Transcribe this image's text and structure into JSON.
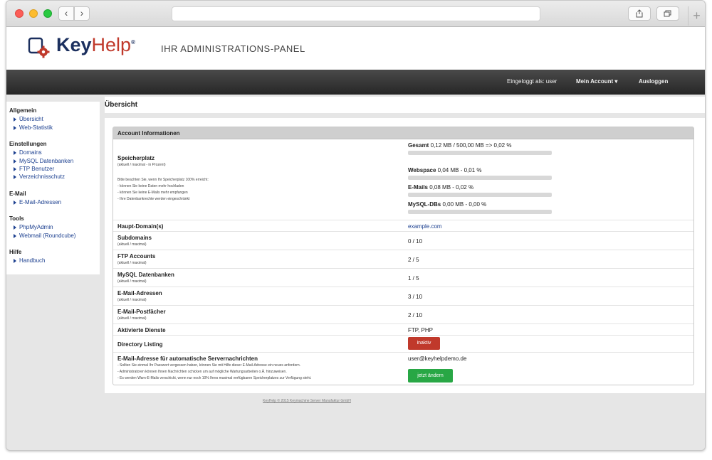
{
  "header": {
    "logo_key": "Key",
    "logo_help": "Help",
    "logo_reg": "®",
    "tagline": "IHR ADMINISTRATIONS-PANEL"
  },
  "topnav": {
    "logged_in": "Eingeloggt als: user",
    "account": "Mein Account ▾",
    "logout": "Ausloggen"
  },
  "sidebar": {
    "sections": [
      {
        "title": "Allgemein",
        "items": [
          "Übersicht",
          "Web-Statistik"
        ]
      },
      {
        "title": "Einstellungen",
        "items": [
          "Domains",
          "MySQL Datenbanken",
          "FTP Benutzer",
          "Verzeichnisschutz"
        ]
      },
      {
        "title": "E-Mail",
        "items": [
          "E-Mail-Adressen"
        ]
      },
      {
        "title": "Tools",
        "items": [
          "PhpMyAdmin",
          "Webmail (Roundcube)"
        ]
      },
      {
        "title": "Hilfe",
        "items": [
          "Handbuch"
        ]
      }
    ]
  },
  "page_title": "Übersicht",
  "panel": {
    "title": "Account Informationen",
    "storage": {
      "label": "Speicherplatz",
      "sub": "(aktuell / maximal - in Prozent)",
      "notes": [
        "Bitte beachten Sie, wenn Ihr Speicherplatz 100% erreicht:",
        "- können Sie keine Daten mehr hochladen",
        "- können Sie keine E-Mails mehr empfangen",
        "- Ihre Datenbankrechte werden eingeschränkt"
      ],
      "lines": [
        {
          "name": "Gesamt",
          "value": "0,12 MB / 500,00 MB => 0,02 %",
          "percent": 0.02
        },
        {
          "name": "Webspace",
          "value": "0,04 MB - 0,01 %",
          "percent": 0.01
        },
        {
          "name": "E-Mails",
          "value": "0,08 MB - 0,02 %",
          "percent": 0.02
        },
        {
          "name": "MySQL-DBs",
          "value": "0,00 MB - 0,00 %",
          "percent": 0.0
        }
      ]
    },
    "rows": {
      "main_domain": {
        "label": "Haupt-Domain(s)",
        "value": "example.com"
      },
      "subdomains": {
        "label": "Subdomains",
        "sub": "(aktuell / maximal)",
        "value": "0 / 10"
      },
      "ftp": {
        "label": "FTP Accounts",
        "sub": "(aktuell / maximal)",
        "value": "2 / 5"
      },
      "mysql": {
        "label": "MySQL Datenbanken",
        "sub": "(aktuell / maximal)",
        "value": "1 / 5"
      },
      "email_addr": {
        "label": "E-Mail-Adressen",
        "sub": "(aktuell / maximal)",
        "value": "3 / 10"
      },
      "mailbox": {
        "label": "E-Mail-Postfächer",
        "sub": "(aktuell / maximal)",
        "value": "2 / 10"
      },
      "services": {
        "label": "Aktivierte Dienste",
        "value": "FTP, PHP"
      },
      "dirlist": {
        "label": "Directory Listing",
        "button": "inaktiv"
      },
      "notify": {
        "label": "E-Mail-Adresse für automatische Servernachrichten",
        "value": "user@keyhelpdemo.de",
        "button": "jetzt ändern",
        "notes": [
          "- Sollten Sie einmal Ihr Passwort vergessen haben, können Sie mit Hilfe dieser E-Mail-Adresse ein neues anfordern.",
          "- Administratoren können Ihnen Nachrichten schicken um auf mögliche Wartungsarbeiten o.Ä. hinzuweisen.",
          "- Es werden Warn-E-Mails verschickt, wenn nur noch 10% Ihres maximal verfügbaren Speicherplatzes zur Verfügung steht."
        ]
      }
    }
  },
  "footer": "KeyHelp © 2015 Keymachine Server Manufaktur GmbH",
  "colors": {
    "brand_blue": "#1b2f5e",
    "brand_red": "#c0392b",
    "button_green": "#28a745",
    "nav_dark": "#2f2f2f"
  }
}
